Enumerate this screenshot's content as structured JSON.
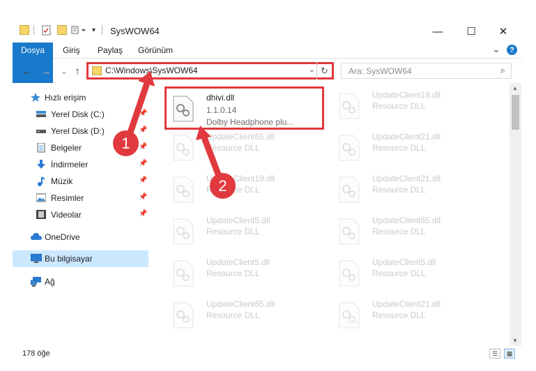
{
  "window": {
    "title": "SysWOW64",
    "minimize_glyph": "—",
    "maximize_glyph": "☐",
    "close_glyph": "✕"
  },
  "ribbon": {
    "tabs": [
      "Dosya",
      "Giriş",
      "Paylaş",
      "Görünüm"
    ],
    "collapse_glyph": "⌄",
    "help_glyph": "?"
  },
  "nav": {
    "back_glyph": "←",
    "forward_glyph": "→",
    "recent_glyph": "⌄",
    "up_glyph": "↑"
  },
  "address": {
    "path": "C:\\Windows\\SysWOW64",
    "dropdown_glyph": "⌄",
    "refresh_glyph": "↻"
  },
  "search": {
    "placeholder": "Ara: SysWOW64",
    "icon_glyph": "⌕"
  },
  "sidebar": {
    "items": [
      {
        "label": "Hızlı erişim",
        "icon": "star-icon",
        "pinned": false
      },
      {
        "label": "Yerel Disk (C:)",
        "icon": "drive-icon",
        "pinned": true
      },
      {
        "label": "Yerel Disk (D:)",
        "icon": "drive-icon",
        "pinned": true
      },
      {
        "label": "Belgeler",
        "icon": "documents-icon",
        "pinned": true
      },
      {
        "label": "İndirmeler",
        "icon": "download-icon",
        "pinned": true
      },
      {
        "label": "Müzik",
        "icon": "music-icon",
        "pinned": true
      },
      {
        "label": "Resimler",
        "icon": "pictures-icon",
        "pinned": true
      },
      {
        "label": "Videolar",
        "icon": "videos-icon",
        "pinned": true
      },
      {
        "label": "OneDrive",
        "icon": "cloud-icon",
        "pinned": false
      },
      {
        "label": "Bu bilgisayar",
        "icon": "computer-icon",
        "pinned": false,
        "selected": true
      },
      {
        "label": "Ağ",
        "icon": "network-icon",
        "pinned": false
      }
    ],
    "pin_glyph": "📌"
  },
  "files": {
    "highlighted": {
      "name": "dhivi.dll",
      "version": "1.1.0.14",
      "description": "Dolby Headphone plu..."
    },
    "left_column": [
      {
        "name": "UpdateClient65.dll",
        "sub": "Resource DLL"
      },
      {
        "name": "UpdateClient19.dll",
        "sub": "Resource DLL"
      },
      {
        "name": "UpdateClient5.dll",
        "sub": "Resource DLL"
      },
      {
        "name": "UpdateClient5.dll",
        "sub": "Resource DLL"
      },
      {
        "name": "UpdateClient65.dll",
        "sub": "Resource DLL"
      }
    ],
    "right_column": [
      {
        "name": "UpdateClient19.dll",
        "sub": "Resource DLL"
      },
      {
        "name": "UpdateClient21.dll",
        "sub": "Resource DLL"
      },
      {
        "name": "UpdateClient21.dll",
        "sub": "Resource DLL"
      },
      {
        "name": "UpdateClient65.dll",
        "sub": "Resource DLL"
      },
      {
        "name": "UpdateClient5.dll",
        "sub": "Resource DLL"
      },
      {
        "name": "UpdateClient21.dll",
        "sub": "Resource DLL"
      }
    ]
  },
  "callouts": {
    "one": "1",
    "two": "2"
  },
  "status": {
    "item_count": "178 öğe"
  },
  "colors": {
    "accent": "#1979ca",
    "highlight_red": "#e0393e",
    "selection": "#cce8ff"
  }
}
